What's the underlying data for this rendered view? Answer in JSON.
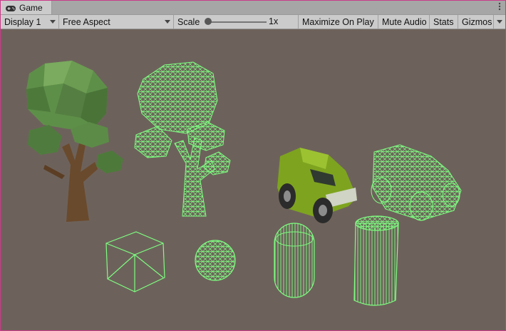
{
  "tab": {
    "title": "Game",
    "icon": "gamepad-icon"
  },
  "toolbar": {
    "display": "Display 1",
    "aspect": "Free Aspect",
    "scale_label": "Scale",
    "scale_value": "1x",
    "scale_level": 0.0,
    "maximize": "Maximize On Play",
    "mute": "Mute Audio",
    "stats": "Stats",
    "gizmos": "Gizmos"
  },
  "scene": {
    "background": "#6d625b",
    "wire_color": "#7dff80",
    "objects": [
      "tree-shaded",
      "tree-wireframe",
      "jeep-shaded",
      "jeep-wireframe",
      "cube-wireframe",
      "sphere-wireframe",
      "capsule-wireframe",
      "cylinder-wireframe"
    ]
  }
}
